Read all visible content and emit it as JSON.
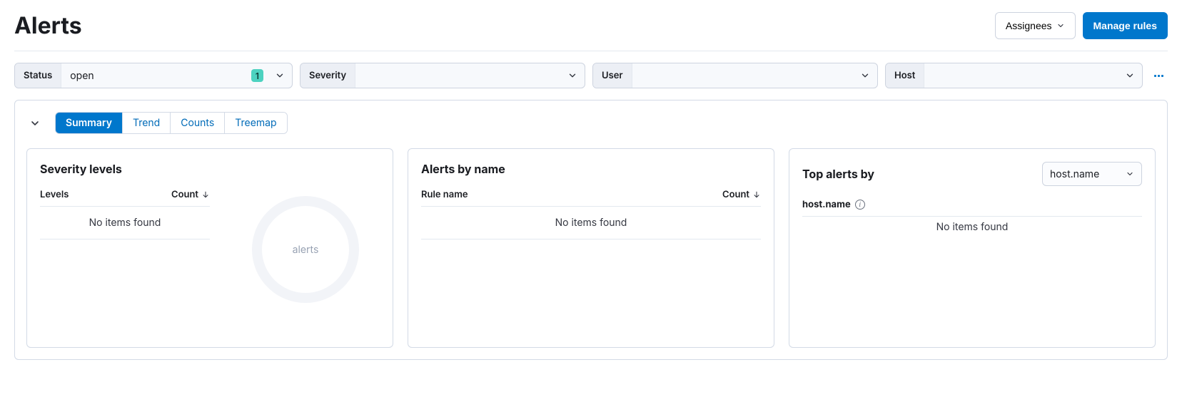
{
  "header": {
    "title": "Alerts",
    "assignees_label": "Assignees",
    "manage_rules_label": "Manage rules"
  },
  "filters": {
    "status": {
      "label": "Status",
      "value": "open",
      "count": "1"
    },
    "severity": {
      "label": "Severity",
      "value": ""
    },
    "user": {
      "label": "User",
      "value": ""
    },
    "host": {
      "label": "Host",
      "value": ""
    }
  },
  "tabs": {
    "summary": "Summary",
    "trend": "Trend",
    "counts": "Counts",
    "treemap": "Treemap"
  },
  "severity_card": {
    "title": "Severity levels",
    "col_levels": "Levels",
    "col_count": "Count",
    "empty": "No items found",
    "center_label": "alerts"
  },
  "byname_card": {
    "title": "Alerts by name",
    "col_rule": "Rule name",
    "col_count": "Count",
    "empty": "No items found"
  },
  "top_card": {
    "title": "Top alerts by",
    "selected": "host.name",
    "sub_label": "host.name",
    "empty": "No items found"
  }
}
